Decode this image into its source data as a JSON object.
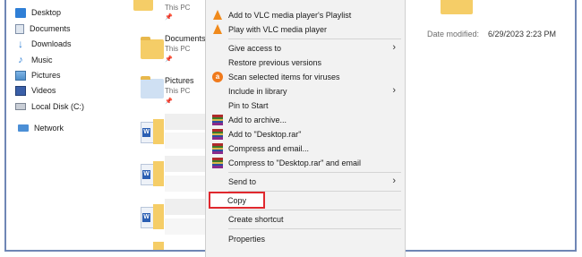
{
  "nav": {
    "items": [
      {
        "label": "Desktop",
        "icon": "desktop-icon"
      },
      {
        "label": "Documents",
        "icon": "documents-icon"
      },
      {
        "label": "Downloads",
        "icon": "downloads-icon"
      },
      {
        "label": "Music",
        "icon": "music-icon"
      },
      {
        "label": "Pictures",
        "icon": "pictures-icon"
      },
      {
        "label": "Videos",
        "icon": "videos-icon"
      },
      {
        "label": "Local Disk (C:)",
        "icon": "local-disk-icon"
      },
      {
        "label": "Network",
        "icon": "network-icon"
      }
    ]
  },
  "files": [
    {
      "name": "",
      "sub": "This PC"
    },
    {
      "name": "Documents",
      "sub": "This PC"
    },
    {
      "name": "Pictures",
      "sub": "This PC"
    }
  ],
  "menu": {
    "items": [
      {
        "label": "Add to VLC media player's Playlist",
        "icon": "vlc-icon"
      },
      {
        "label": "Play with VLC media player",
        "icon": "vlc-icon"
      },
      {
        "label": "Give access to",
        "icon": "",
        "submenu": true
      },
      {
        "label": "Restore previous versions",
        "icon": ""
      },
      {
        "label": "Scan selected items for viruses",
        "icon": "avast-icon"
      },
      {
        "label": "Include in library",
        "icon": "",
        "submenu": true
      },
      {
        "label": "Pin to Start",
        "icon": ""
      },
      {
        "label": "Add to archive...",
        "icon": "winrar-icon"
      },
      {
        "label": "Add to \"Desktop.rar\"",
        "icon": "winrar-icon"
      },
      {
        "label": "Compress and email...",
        "icon": "winrar-icon"
      },
      {
        "label": "Compress to \"Desktop.rar\" and email",
        "icon": "winrar-icon"
      },
      {
        "label": "Send to",
        "icon": "",
        "submenu": true
      },
      {
        "label": "Copy",
        "icon": ""
      },
      {
        "label": "Create shortcut",
        "icon": ""
      },
      {
        "label": "Properties",
        "icon": ""
      }
    ]
  },
  "details": {
    "date_modified_label": "Date modified:",
    "date_modified_value": "6/29/2023 2:23 PM"
  },
  "colors": {
    "highlight": "#e0282e",
    "menu_bg": "#f2f2f2",
    "folder": "#f5cd67"
  }
}
